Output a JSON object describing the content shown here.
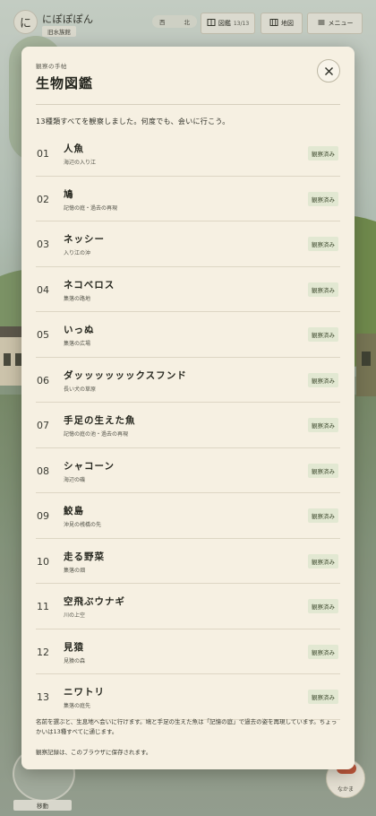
{
  "app": {
    "logo_char": "に",
    "name": "にぽぽぽん",
    "location": "旧水族館",
    "compass": [
      "西",
      "北"
    ]
  },
  "toolbar": {
    "zukan_label": "図鑑",
    "zukan_count": "13/13",
    "map_label": "地図",
    "menu_label": "メニュー"
  },
  "modal": {
    "kicker": "観察の手帖",
    "title": "生物図鑑",
    "intro": "13種類すべてを観察しました。何度でも、会いに行こう。",
    "entries": [
      {
        "num": "01",
        "name": "人魚",
        "location": "海辺の入り江",
        "status": "観察済み"
      },
      {
        "num": "02",
        "name": "鳩",
        "location": "記憶の庭・過去の再現",
        "status": "観察済み"
      },
      {
        "num": "03",
        "name": "ネッシー",
        "location": "入り江の沖",
        "status": "観察済み"
      },
      {
        "num": "04",
        "name": "ネコベロス",
        "location": "集落の路地",
        "status": "観察済み"
      },
      {
        "num": "05",
        "name": "いっぬ",
        "location": "集落の広場",
        "status": "観察済み"
      },
      {
        "num": "06",
        "name": "ダッッッッッックスフンド",
        "location": "長い犬の草原",
        "status": "観察済み"
      },
      {
        "num": "07",
        "name": "手足の生えた魚",
        "location": "記憶の庭の池・過去の再現",
        "status": "観察済み"
      },
      {
        "num": "08",
        "name": "シャコーン",
        "location": "海辺の磯",
        "status": "観察済み"
      },
      {
        "num": "09",
        "name": "鮫島",
        "location": "沖見の桟橋の先",
        "status": "観察済み"
      },
      {
        "num": "10",
        "name": "走る野菜",
        "location": "集落の畑",
        "status": "観察済み"
      },
      {
        "num": "11",
        "name": "空飛ぶウナギ",
        "location": "川の上空",
        "status": "観察済み"
      },
      {
        "num": "12",
        "name": "見猿",
        "location": "見猿の森",
        "status": "観察済み"
      },
      {
        "num": "13",
        "name": "ニワトリ",
        "location": "集落の庭先",
        "status": "観察済み"
      }
    ],
    "note": "名前を選ぶと、生息地へ会いに行けます。鳩と手足の生えた魚は「記憶の庭」で過去の姿を再現しています。ちょっかいは13種すべてに通じます。",
    "save_note": "観察記録は、このブラウザに保存されます。"
  },
  "controls": {
    "move_label": "移動",
    "corner_label": "なかま"
  },
  "colors": {
    "panel": "#f6f0e2",
    "badge_bg": "#e2e8d2",
    "badge_text": "#3e4a2e"
  },
  "icons": [
    "book-icon",
    "map-icon",
    "menu-icon",
    "close-icon"
  ]
}
